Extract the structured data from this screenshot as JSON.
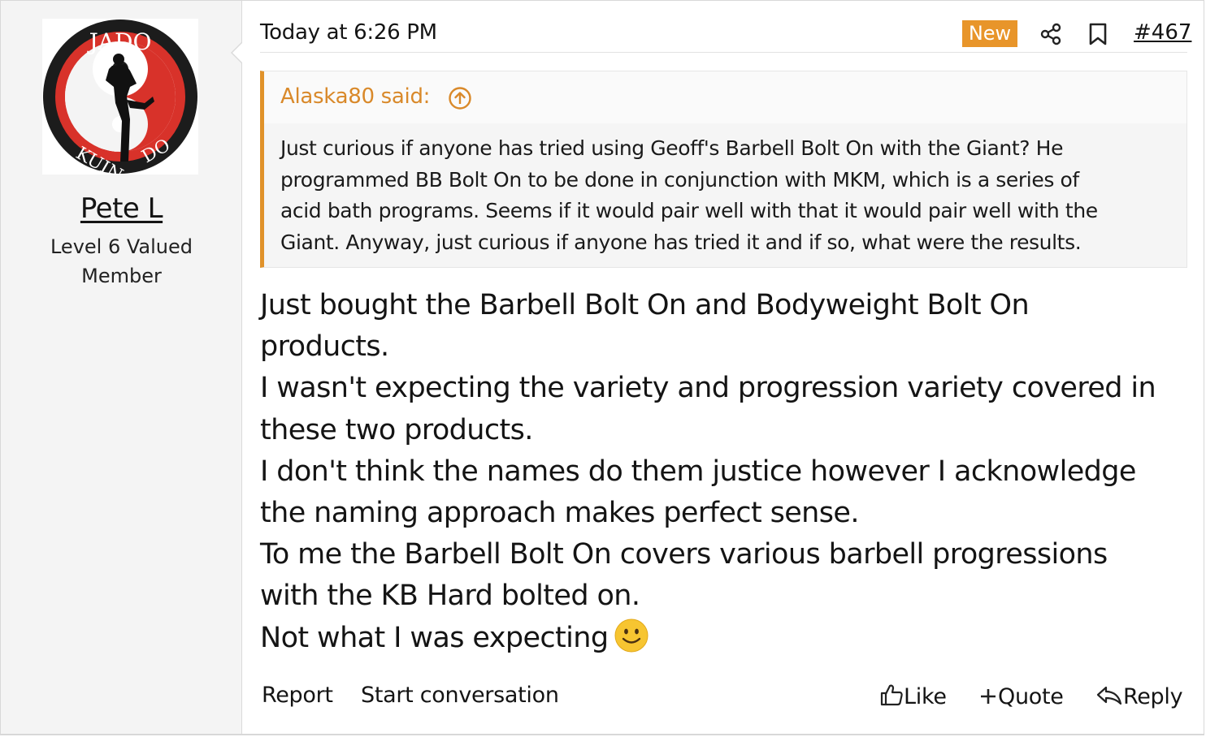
{
  "author": {
    "username": "Pete L",
    "user_title_line1": "Level 6 Valued",
    "user_title_line2": "Member",
    "avatar_text_top": "JADO",
    "avatar_text_bottom_left": "KUIN",
    "avatar_text_bottom_right": "DO"
  },
  "meta": {
    "timestamp": "Today at 6:26 PM",
    "badge": "New",
    "post_number": "#467",
    "icons": [
      "share-icon",
      "bookmark-icon"
    ]
  },
  "quote": {
    "author_label": "Alaska80 said:",
    "lines": [
      "Just curious if anyone has tried using Geoff's Barbell Bolt On with the Giant? He",
      "programmed BB Bolt On to be done in conjunction with MKM, which is a series of",
      "acid bath programs. Seems if it would pair well with that it would pair well with the",
      "Giant. Anyway, just curious if anyone has tried it and if so, what were the results."
    ]
  },
  "message": {
    "lines": [
      "Just bought the Barbell Bolt On and Bodyweight Bolt On",
      "products.",
      "I wasn't expecting the variety and progression variety covered in",
      "these two products.",
      "I don't think the names do them justice however I acknowledge",
      "the naming approach makes perfect sense.",
      "To me the Barbell Bolt On covers various barbell progressions",
      "with the KB Hard bolted on.",
      "Not what I was expecting"
    ],
    "emoji": "smile-emoji"
  },
  "footer": {
    "report": "Report",
    "start_conversation": "Start conversation",
    "like": "Like",
    "quote": "Quote",
    "reply": "Reply"
  },
  "colors": {
    "accent_orange": "#e8952a",
    "quote_border": "#e0922a",
    "user_column_bg": "#f4f4f4"
  }
}
